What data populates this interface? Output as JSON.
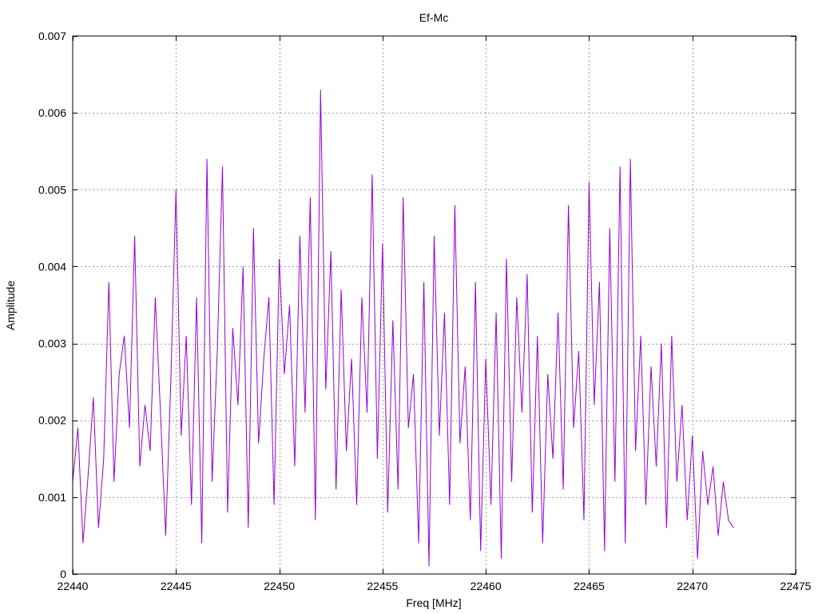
{
  "chart_data": {
    "type": "line",
    "title": "Ef-Mc",
    "xlabel": "Freq [MHz]",
    "ylabel": "Amplitude",
    "xlim": [
      22440,
      22475
    ],
    "ylim": [
      0,
      0.007
    ],
    "x_ticks": [
      22440,
      22445,
      22450,
      22455,
      22460,
      22465,
      22470,
      22475
    ],
    "y_ticks": [
      0,
      0.001,
      0.002,
      0.003,
      0.004,
      0.005,
      0.006,
      0.007
    ],
    "x_tick_labels": [
      "22440",
      "22445",
      "22450",
      "22455",
      "22460",
      "22465",
      "22470",
      "22475"
    ],
    "y_tick_labels": [
      "0",
      "0.001",
      "0.002",
      "0.003",
      "0.004",
      "0.005",
      "0.006",
      "0.007"
    ],
    "grid": true,
    "legend": "none",
    "series": [
      {
        "color": "#9400d3",
        "x": [
          22440.0,
          22440.25,
          22440.5,
          22440.75,
          22441.0,
          22441.25,
          22441.5,
          22441.75,
          22442.0,
          22442.25,
          22442.5,
          22442.75,
          22443.0,
          22443.25,
          22443.5,
          22443.75,
          22444.0,
          22444.25,
          22444.5,
          22444.75,
          22445.0,
          22445.25,
          22445.5,
          22445.75,
          22446.0,
          22446.25,
          22446.5,
          22446.75,
          22447.0,
          22447.25,
          22447.5,
          22447.75,
          22448.0,
          22448.25,
          22448.5,
          22448.75,
          22449.0,
          22449.25,
          22449.5,
          22449.75,
          22450.0,
          22450.25,
          22450.5,
          22450.75,
          22451.0,
          22451.25,
          22451.5,
          22451.75,
          22452.0,
          22452.25,
          22452.5,
          22452.75,
          22453.0,
          22453.25,
          22453.5,
          22453.75,
          22454.0,
          22454.25,
          22454.5,
          22454.75,
          22455.0,
          22455.25,
          22455.5,
          22455.75,
          22456.0,
          22456.25,
          22456.5,
          22456.75,
          22457.0,
          22457.25,
          22457.5,
          22457.75,
          22458.0,
          22458.25,
          22458.5,
          22458.75,
          22459.0,
          22459.25,
          22459.5,
          22459.75,
          22460.0,
          22460.25,
          22460.5,
          22460.75,
          22461.0,
          22461.25,
          22461.5,
          22461.75,
          22462.0,
          22462.25,
          22462.5,
          22462.75,
          22463.0,
          22463.25,
          22463.5,
          22463.75,
          22464.0,
          22464.25,
          22464.5,
          22464.75,
          22465.0,
          22465.25,
          22465.5,
          22465.75,
          22466.0,
          22466.25,
          22466.5,
          22466.75,
          22467.0,
          22467.25,
          22467.5,
          22467.75,
          22468.0,
          22468.25,
          22468.5,
          22468.75,
          22469.0,
          22469.25,
          22469.5,
          22469.75,
          22470.0,
          22470.25,
          22470.5,
          22470.75,
          22471.0,
          22471.25,
          22471.5,
          22471.75,
          22472.0
        ],
        "y": [
          0.0012,
          0.0019,
          0.0004,
          0.0013,
          0.0023,
          0.0006,
          0.0015,
          0.0038,
          0.0012,
          0.0026,
          0.0031,
          0.0019,
          0.0044,
          0.0014,
          0.0022,
          0.0016,
          0.0036,
          0.0021,
          0.0005,
          0.0025,
          0.005,
          0.0018,
          0.0031,
          0.0009,
          0.0036,
          0.0004,
          0.0054,
          0.0012,
          0.0029,
          0.0053,
          0.0008,
          0.0032,
          0.0022,
          0.004,
          0.0006,
          0.0045,
          0.0017,
          0.0028,
          0.0036,
          0.0009,
          0.0041,
          0.0026,
          0.0035,
          0.0014,
          0.0044,
          0.0021,
          0.0049,
          0.0007,
          0.0063,
          0.0024,
          0.0042,
          0.0011,
          0.0037,
          0.0016,
          0.0028,
          0.0009,
          0.0036,
          0.0021,
          0.0052,
          0.0015,
          0.0043,
          0.0008,
          0.0033,
          0.0011,
          0.0049,
          0.0019,
          0.0026,
          0.0004,
          0.0038,
          0.0001,
          0.0044,
          0.0018,
          0.0034,
          0.0009,
          0.0048,
          0.0017,
          0.0027,
          0.0007,
          0.0038,
          0.0003,
          0.0028,
          0.0009,
          0.0034,
          0.0002,
          0.0041,
          0.0012,
          0.0036,
          0.0021,
          0.0039,
          0.0008,
          0.0031,
          0.0004,
          0.0026,
          0.0015,
          0.0034,
          0.0011,
          0.0048,
          0.0019,
          0.0029,
          0.0007,
          0.0051,
          0.0022,
          0.0038,
          0.0003,
          0.0045,
          0.0012,
          0.0053,
          0.0004,
          0.0054,
          0.0016,
          0.0031,
          0.0009,
          0.0027,
          0.0014,
          0.003,
          0.0006,
          0.0031,
          0.0012,
          0.0022,
          0.0007,
          0.0018,
          0.0002,
          0.0016,
          0.0009,
          0.0014,
          0.0005,
          0.0012,
          0.0007,
          0.0006
        ]
      }
    ]
  }
}
